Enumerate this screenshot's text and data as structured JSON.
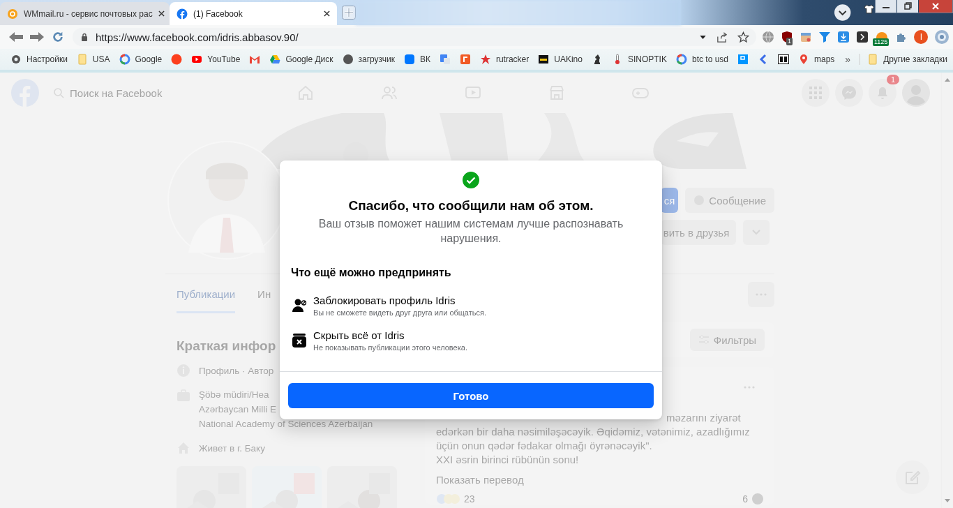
{
  "browser": {
    "tabs": [
      {
        "title": "WMmail.ru - сервис почтовых рас",
        "selected": false
      },
      {
        "title": "(1) Facebook",
        "selected": true
      }
    ],
    "address": "https://www.facebook.com/idris.abbasov.90/",
    "shield_badge": "1",
    "coin_badge": "1125",
    "profile_initial": "I",
    "bookmarks": [
      "Настройки",
      "USA",
      "Google",
      "YouTube",
      "Google Диск",
      "загрузчик",
      "ВК",
      "rutracker",
      "UAKino",
      "SINOPTIK",
      "btc to usd",
      "maps"
    ],
    "more_bookmarks": "»",
    "other_bookmarks": "Другие закладки"
  },
  "facebook": {
    "search_placeholder": "Поиск на Facebook",
    "notification_count": "1",
    "profile_buttons": [
      "ся",
      "Сообщение"
    ],
    "add_friend": "вить в друзья",
    "tabs": [
      {
        "label": "Публикации",
        "selected": true
      },
      {
        "label": "Ин",
        "selected": false
      }
    ],
    "intro": {
      "title": "Краткая инфор",
      "profile_line": "Профиль · Автор",
      "work_lines": [
        "Şöbə müdiri/Hea",
        "Azərbaycan Milli E",
        "National Academy of Sciences Azerbaijan"
      ],
      "lives": "Живет в г. Баку"
    },
    "filters": "Фильтры",
    "post": {
      "lines": [
        "məzarını ziyarət",
        "edərkən bir daha nəsimiləşəcəyik. Əqidəmiz, vətənimiz, azadlığımız",
        "üçün onun qədər fədakar olmağı öyrənəcəyik\".",
        "XXI əsrin birinci rübünün sonu!"
      ],
      "translate": "Показать перевод",
      "reactions": "23",
      "comments": "6"
    }
  },
  "dialog": {
    "title": "Спасибо, что сообщили нам об этом.",
    "subtitle": "Ваш отзыв поможет нашим системам лучше распознавать нарушения.",
    "section": "Что ещё можно предпринять",
    "options": [
      {
        "title": "Заблокировать профиль Idris",
        "description": "Вы не сможете видеть друг друга или общаться."
      },
      {
        "title": "Скрыть всё от Idris",
        "description": "Не показывать публикации этого человека."
      }
    ],
    "button": "Готово"
  }
}
